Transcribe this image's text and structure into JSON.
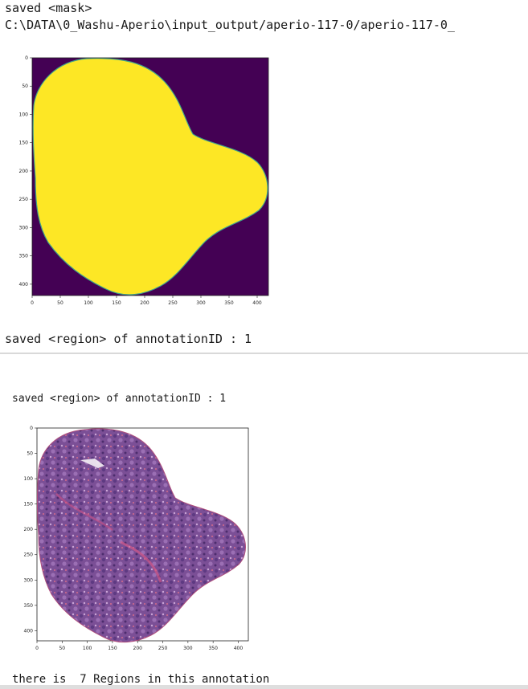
{
  "output": {
    "line1": "saved <mask>",
    "line2": "C:\\DATA\\0_Washu-Aperio\\input_output/aperio-117-0/aperio-117-0_",
    "line3": "saved <region> of annotationID : 1",
    "line4": "saved <region> of annotationID : 1",
    "line5": "there is  7 Regions in this annotation"
  },
  "colors": {
    "mask_background": "#440154",
    "mask_foreground": "#fde725"
  },
  "chart_data": [
    {
      "type": "image",
      "x_ticks": [
        "0",
        "50",
        "100",
        "150",
        "200",
        "250",
        "300",
        "350",
        "400"
      ],
      "y_ticks": [
        "0",
        "50",
        "100",
        "150",
        "200",
        "250",
        "300",
        "350",
        "400"
      ],
      "xlim": [
        0,
        420
      ],
      "ylim": [
        420,
        0
      ]
    },
    {
      "type": "image",
      "x_ticks": [
        "0",
        "50",
        "100",
        "150",
        "200",
        "250",
        "300",
        "350",
        "400"
      ],
      "y_ticks": [
        "0",
        "50",
        "100",
        "150",
        "200",
        "250",
        "300",
        "350",
        "400"
      ],
      "xlim": [
        0,
        420
      ],
      "ylim": [
        420,
        0
      ]
    }
  ]
}
